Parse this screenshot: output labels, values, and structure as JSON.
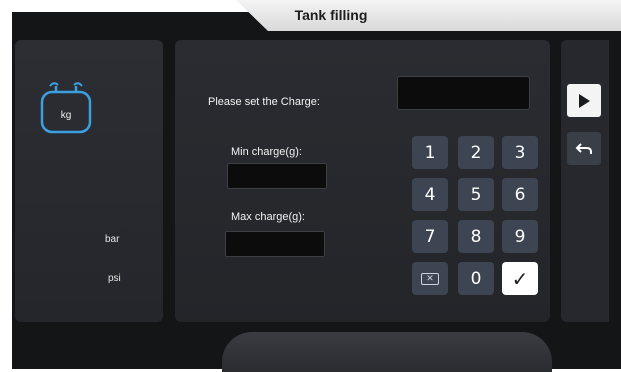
{
  "header": {
    "title": "Tank filling"
  },
  "left_panel": {
    "tank_unit": "kg",
    "units": [
      "bar",
      "psi"
    ]
  },
  "form": {
    "prompt": "Please set the Charge:",
    "charge_value": "",
    "min_label": "Min charge(g):",
    "min_value": "",
    "max_label": "Max charge(g):",
    "max_value": ""
  },
  "keypad": {
    "keys": [
      "1",
      "2",
      "3",
      "4",
      "5",
      "6",
      "7",
      "8",
      "9"
    ],
    "backspace_glyph": "✕",
    "zero": "0",
    "confirm_glyph": "✓"
  },
  "icons": {
    "tank": "tank-icon",
    "play": "play-icon",
    "back": "return-icon",
    "backspace": "backspace-icon",
    "confirm": "check-icon"
  },
  "colors": {
    "background": "#141517",
    "panel": "#2a2c31",
    "key": "#3d4553",
    "accent_blue": "#3aa0e0",
    "title_tab": "#e8e8e8"
  }
}
